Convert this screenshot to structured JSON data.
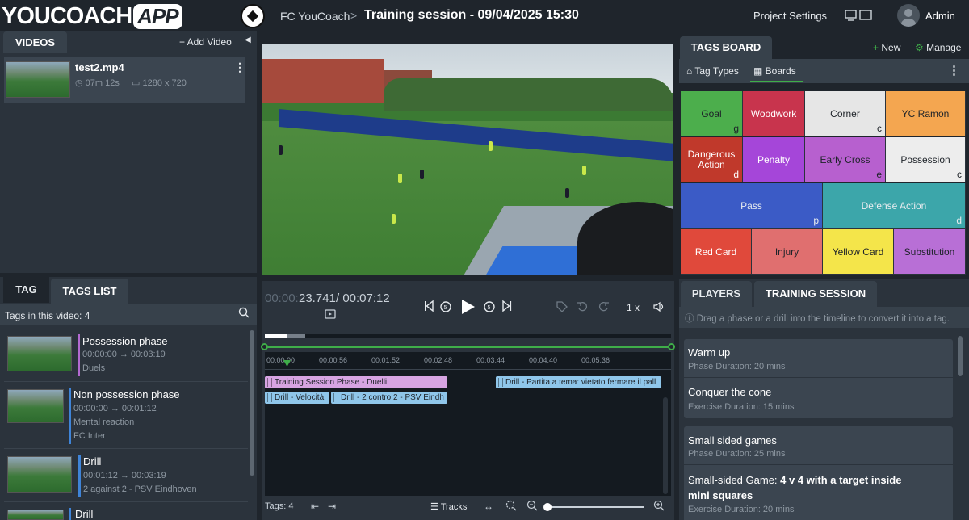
{
  "header": {
    "logo_text": "YOUCOACH",
    "logo_app": "APP",
    "team": "FC YouCoach",
    "separator": ">",
    "session_title": "Training session - 09/04/2025 15:30",
    "project_settings": "Project Settings",
    "user": "Admin"
  },
  "videos": {
    "tab": "VIDEOS",
    "add_label": "+ Add Video",
    "items": [
      {
        "name": "test2.mp4",
        "duration": "07m 12s",
        "resolution": "1280 x 720"
      }
    ]
  },
  "tag_panel": {
    "tab_tag": "TAG",
    "tab_list": "TAGS LIST",
    "count_label": "Tags in this video: 4",
    "items": [
      {
        "title": "Possession phase",
        "time": "00:00:00 → 00:03:19",
        "sub1": "Duels",
        "sub2": "",
        "color": "#b36ad1"
      },
      {
        "title": "Non possession phase",
        "time": "00:00:00 → 00:01:12",
        "sub1": "Mental reaction",
        "sub2": "FC Inter",
        "color": "#3f84d8"
      },
      {
        "title": "Drill",
        "time": "00:01:12 → 00:03:19",
        "sub1": "2 against 2 - PSV Eindhoven",
        "sub2": "",
        "color": "#3f84d8"
      },
      {
        "title": "Drill",
        "time": "",
        "sub1": "",
        "sub2": "",
        "color": "#3f84d8"
      }
    ]
  },
  "player_controls": {
    "current_dim": "00:00:",
    "current": "23.741",
    "total": "/ 00:07:12",
    "speed": "1 x"
  },
  "timeline": {
    "ticks": [
      "00:00:00",
      "00:00:56",
      "00:01:52",
      "00:02:48",
      "00:03:44",
      "00:04:40",
      "00:05:36"
    ],
    "segments": [
      {
        "label": "Training Session Phase - Duelli",
        "color": "#d7a4e2"
      },
      {
        "label": "Drill - Partita a tema: vietato fermare il pall",
        "color": "#8fc6ea"
      },
      {
        "label": "Drill - Velocità",
        "color": "#8fc6ea"
      },
      {
        "label": "Drill - 2 contro 2 - PSV Eindh",
        "color": "#8fc6ea"
      }
    ],
    "footer_tags": "Tags: 4",
    "tracks": "Tracks"
  },
  "tags_board": {
    "tab": "TAGS BOARD",
    "new": "+ New",
    "manage": "Manage",
    "sub_tab_types": "Tag Types",
    "sub_tab_boards": "Boards",
    "rows": [
      [
        {
          "label": "Goal",
          "key": "g",
          "color": "#4cae4c",
          "text": "#1e2329"
        },
        {
          "label": "Woodwork",
          "key": "",
          "color": "#c8344d",
          "text": "#ffffff"
        },
        {
          "label": "Corner",
          "key": "c",
          "color": "#e6e6e6",
          "text": "#1e2329"
        },
        {
          "label": "YC Ramon",
          "key": "",
          "color": "#f4a650",
          "text": "#1e2329"
        }
      ],
      [
        {
          "label": "Dangerous Action",
          "key": "d",
          "color": "#c0392b",
          "text": "#ffffff"
        },
        {
          "label": "Penalty",
          "key": "",
          "color": "#a546d9",
          "text": "#ffffff"
        },
        {
          "label": "Early Cross",
          "key": "e",
          "color": "#b760cf",
          "text": "#1e2329"
        },
        {
          "label": "Possession",
          "key": "c",
          "color": "#ededed",
          "text": "#1e2329"
        }
      ],
      [
        {
          "label": "Pass",
          "key": "p",
          "color": "#3b5bc6",
          "text": "#e8ecef"
        },
        {
          "label": "Defense Action",
          "key": "d",
          "color": "#3ca6aa",
          "text": "#e8ecef"
        }
      ],
      [
        {
          "label": "Red Card",
          "key": "",
          "color": "#e0493b",
          "text": "#ffffff"
        },
        {
          "label": "Injury",
          "key": "",
          "color": "#e06f6f",
          "text": "#1e2329"
        },
        {
          "label": "Yellow Card",
          "key": "",
          "color": "#f4e54a",
          "text": "#1e2329"
        },
        {
          "label": "Substitution",
          "key": "",
          "color": "#b86fd6",
          "text": "#1e2329"
        }
      ]
    ]
  },
  "session": {
    "tab_players": "PLAYERS",
    "tab_training": "TRAINING SESSION",
    "hint": "Drag a phase or a drill into the timeline to convert it into a tag.",
    "groups": [
      {
        "items": [
          {
            "title": "Warm up",
            "title_bold": "",
            "title2": "",
            "meta": "Phase Duration: 20 mins"
          },
          {
            "title": "Conquer the cone",
            "title_bold": "",
            "title2": "",
            "meta": "Exercise Duration: 15 mins"
          }
        ]
      },
      {
        "items": [
          {
            "title": "Small sided games",
            "title_bold": "",
            "title2": "",
            "meta": "Phase Duration: 25 mins"
          },
          {
            "title": "Small-sided Game:",
            "title_bold": "4 v 4 with a target inside",
            "title2": "mini squares",
            "meta": "Exercise Duration: 20 mins"
          }
        ]
      }
    ]
  },
  "colors": {
    "accent_green": "#3fae49",
    "bg": "#1f252c",
    "panel": "#2b333c"
  }
}
